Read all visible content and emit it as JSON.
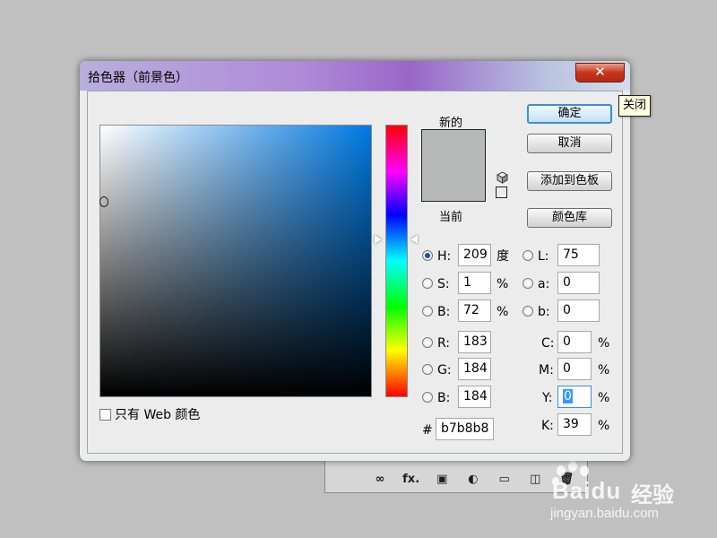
{
  "dialog": {
    "title": "拾色器（前景色）",
    "close_label": "✕",
    "tooltip": "关闭"
  },
  "preview": {
    "new_label": "新的",
    "current_label": "当前",
    "swatch_color": "#b7b8b8"
  },
  "buttons": {
    "ok": "确定",
    "cancel": "取消",
    "add_to_swatches": "添加到色板",
    "color_libraries": "颜色库"
  },
  "fields": {
    "H": {
      "label": "H:",
      "value": "209",
      "unit": "度",
      "checked": true
    },
    "S": {
      "label": "S:",
      "value": "1",
      "unit": "%"
    },
    "B": {
      "label": "B:",
      "value": "72",
      "unit": "%"
    },
    "R": {
      "label": "R:",
      "value": "183"
    },
    "G": {
      "label": "G:",
      "value": "184"
    },
    "Bl": {
      "label": "B:",
      "value": "184"
    },
    "L": {
      "label": "L:",
      "value": "75"
    },
    "a": {
      "label": "a:",
      "value": "0"
    },
    "b": {
      "label": "b:",
      "value": "0"
    },
    "C": {
      "label": "C:",
      "value": "0",
      "unit": "%"
    },
    "M": {
      "label": "M:",
      "value": "0",
      "unit": "%"
    },
    "Y": {
      "label": "Y:",
      "value": "0",
      "unit": "%"
    },
    "K": {
      "label": "K:",
      "value": "39",
      "unit": "%"
    },
    "hex": {
      "label": "#",
      "value": "b7b8b8"
    }
  },
  "web_only": {
    "label": "只有 Web 颜色",
    "checked": false
  },
  "field_colors": {
    "base_hue": "#0078e1"
  },
  "layers_toolbar": {
    "icons": [
      "link-icon",
      "fx-icon",
      "mask-icon",
      "adjustment-icon",
      "folder-icon",
      "new-layer-icon",
      "trash-icon"
    ],
    "fx_label": "fx."
  },
  "watermark": {
    "brand": "Bai",
    "brand_suffix": "du",
    "brand_cn": "经验",
    "url": "jingyan.baidu.com"
  }
}
